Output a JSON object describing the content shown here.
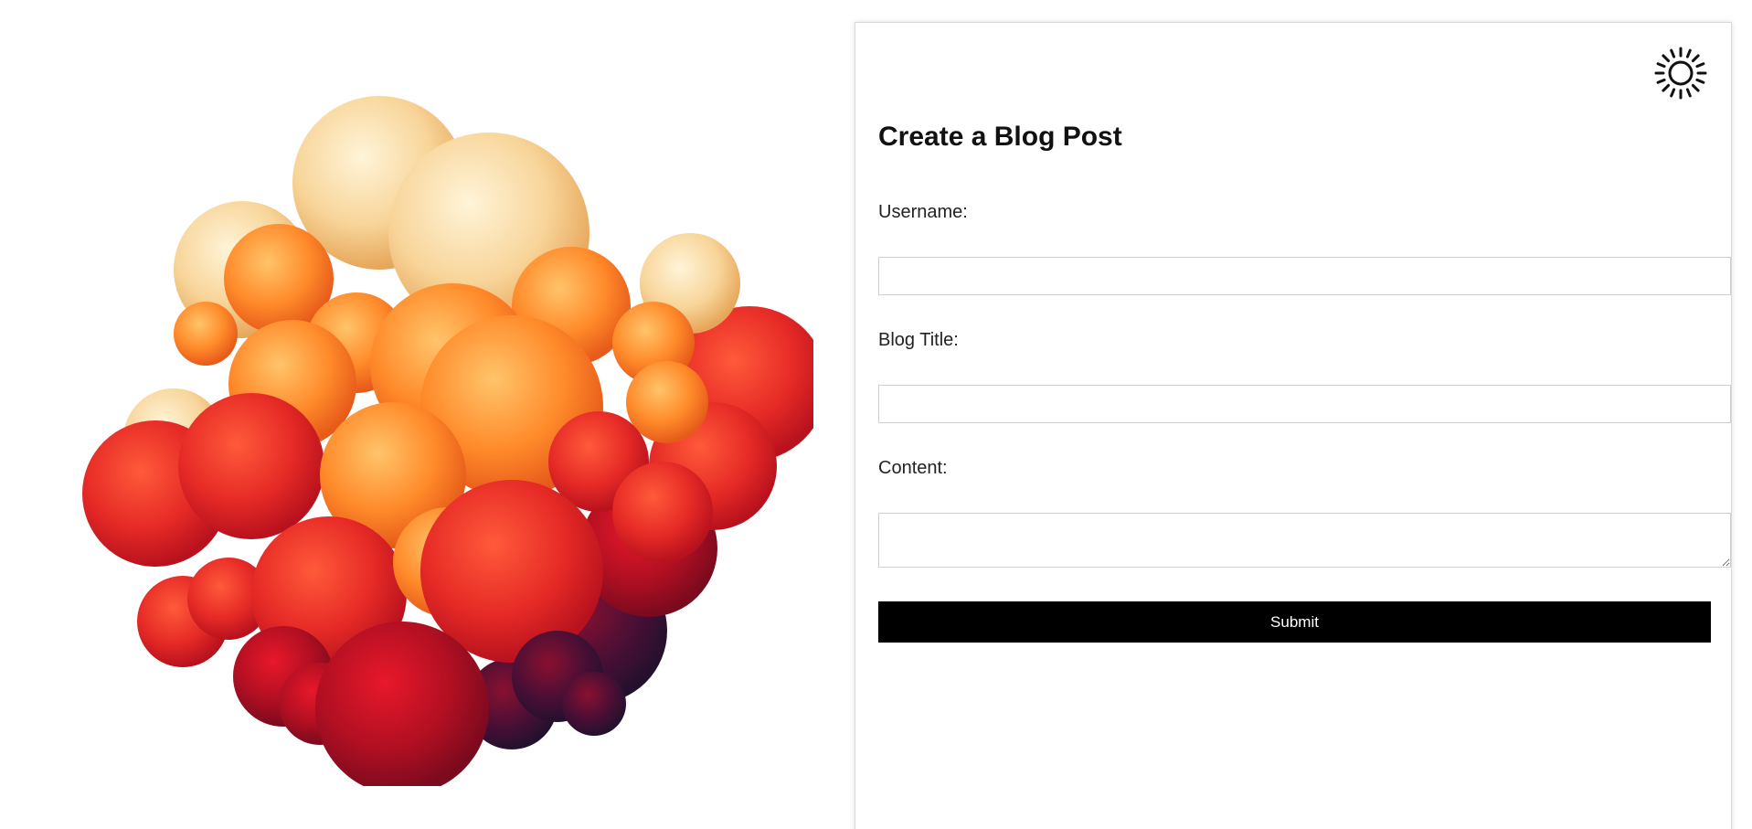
{
  "hero": {
    "image": "orange-red-bubble-cluster",
    "colors": {
      "top": "#fbe8b8",
      "mid": "#ff8a2a",
      "low": "#e01a2a",
      "dark": "#3a0f3a"
    }
  },
  "form": {
    "theme_icon": "sun-icon",
    "title": "Create a Blog Post",
    "username_label": "Username:",
    "username_value": "",
    "blog_title_label": "Blog Title:",
    "blog_title_value": "",
    "content_label": "Content:",
    "content_value": "",
    "submit_label": "Submit"
  }
}
